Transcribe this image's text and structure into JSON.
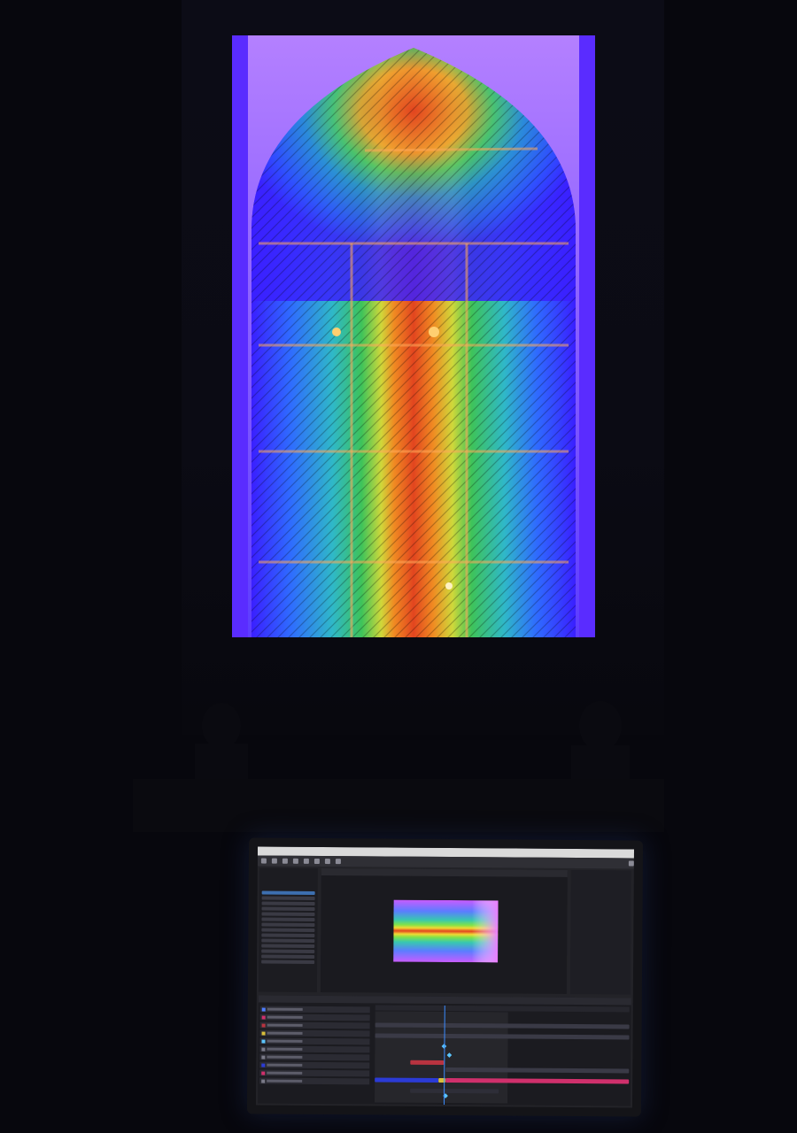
{
  "scene": {
    "projection_colors": [
      "#3a1fff",
      "#2f6bff",
      "#2fb8c8",
      "#3ec35a",
      "#e9e23a",
      "#f08a22",
      "#e2451f",
      "#b03a20"
    ],
    "niche_glow": "#8a56ff"
  },
  "monitor": {
    "app": {
      "accent": "#4da3ff",
      "gradient_preview_colors": [
        "#c85cff",
        "#5b7dff",
        "#38c8b0",
        "#7fe24a",
        "#f1d933",
        "#f08a22",
        "#e2451f"
      ]
    },
    "timeline": {
      "bar_colors": [
        "#2b3bd6",
        "#d0306c",
        "#d8be3a",
        "#b83340",
        "#5cc6ff"
      ]
    }
  }
}
